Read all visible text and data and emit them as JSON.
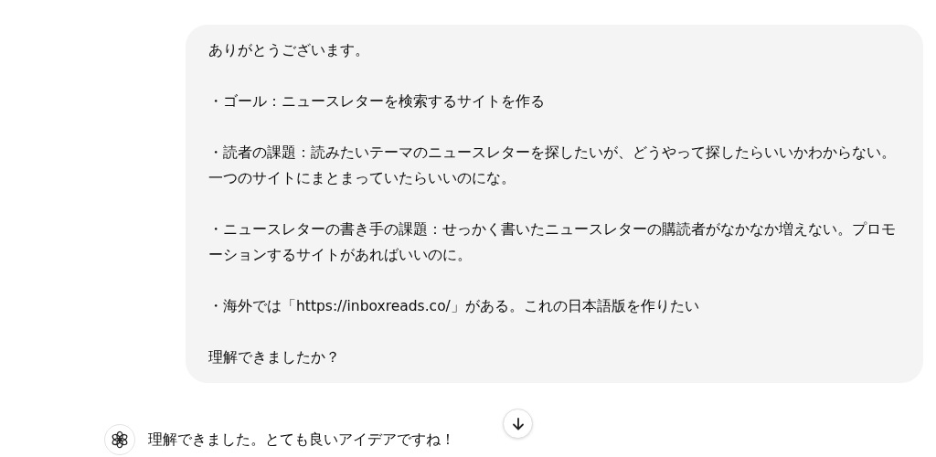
{
  "user_message": {
    "paragraphs": [
      "ありがとうございます。",
      "・ゴール：ニュースレターを検索するサイトを作る",
      "・読者の課題：読みたいテーマのニュースレターを探したいが、どうやって探したらいいかわからない。一つのサイトにまとまっていたらいいのにな。",
      "・ニュースレターの書き手の課題：せっかく書いたニュースレターの購読者がなかなか増えない。プロモーションするサイトがあればいいのに。",
      "・海外では「https://inboxreads.co/」がある。これの日本語版を作りたい",
      "理解できましたか？"
    ]
  },
  "assistant_message": {
    "text": "理解できました。とても良いアイデアですね！"
  }
}
